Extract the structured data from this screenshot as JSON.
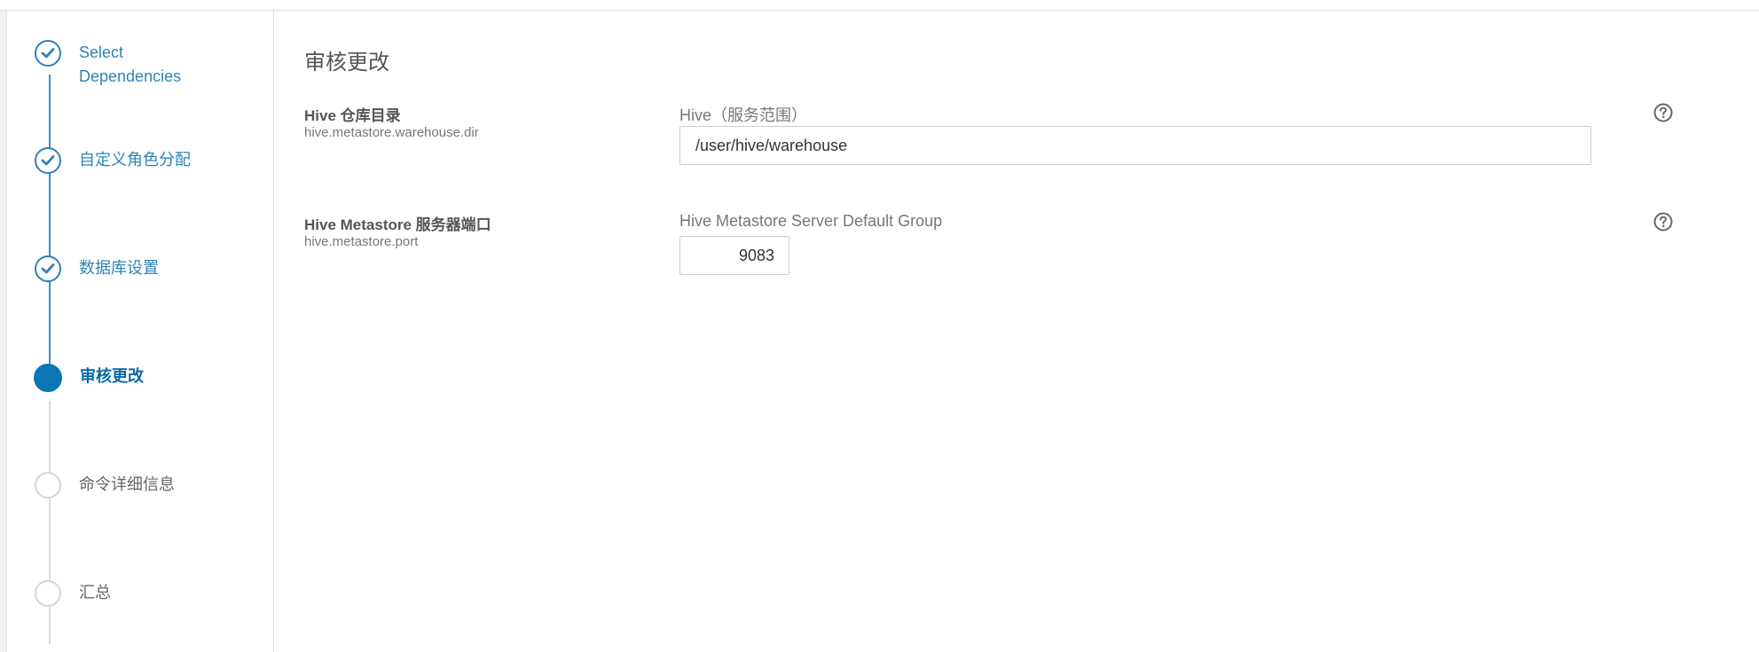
{
  "steps": [
    {
      "label": "Select Dependencies",
      "state": "done"
    },
    {
      "label": "自定义角色分配",
      "state": "done"
    },
    {
      "label": "数据库设置",
      "state": "done"
    },
    {
      "label": "审核更改",
      "state": "current"
    },
    {
      "label": "命令详细信息",
      "state": "todo"
    },
    {
      "label": "汇总",
      "state": "todo"
    }
  ],
  "main": {
    "title": "审核更改",
    "properties": [
      {
        "name": "Hive 仓库目录",
        "key": "hive.metastore.warehouse.dir",
        "scope": "Hive（服务范围）",
        "value": "/user/hive/warehouse"
      },
      {
        "name": "Hive Metastore 服务器端口",
        "key": "hive.metastore.port",
        "scope": "Hive Metastore Server Default Group",
        "value": "9083"
      }
    ]
  },
  "colors": {
    "accent": "#0a76b4",
    "step_done": "#2f83b8",
    "step_todo": "#d4d4d4"
  },
  "icons": {
    "step_done": "check-icon",
    "help": "question-circle-icon"
  }
}
